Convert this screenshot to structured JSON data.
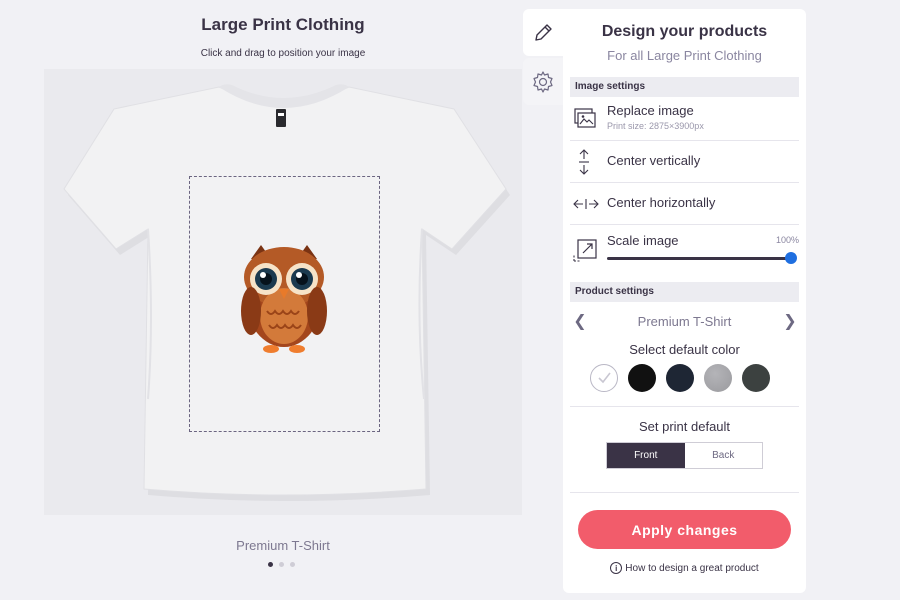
{
  "preview": {
    "title": "Large Print Clothing",
    "hint": "Click and drag to position your image",
    "product_caption": "Premium T-Shirt",
    "carousel": {
      "pages": 3,
      "active_index": 0
    }
  },
  "panel": {
    "title": "Design your products",
    "subtitle": "For all Large Print Clothing",
    "image_settings": {
      "heading": "Image settings",
      "replace_label": "Replace image",
      "print_size": "Print size: 2875×3900px",
      "center_vertical_label": "Center vertically",
      "center_horizontal_label": "Center horizontally",
      "scale_label": "Scale image",
      "scale_value": "100%",
      "scale_fraction": 1.0
    },
    "product_settings": {
      "heading": "Product settings",
      "product_name": "Premium T-Shirt",
      "color_label": "Select default color",
      "colors": [
        {
          "name": "white",
          "hex": "#ffffff",
          "selected": true
        },
        {
          "name": "black",
          "hex": "#111111",
          "selected": false
        },
        {
          "name": "navy",
          "hex": "#1e2634",
          "selected": false
        },
        {
          "name": "heather-grey",
          "hex": "#9a9a9e",
          "selected": false
        },
        {
          "name": "charcoal",
          "hex": "#3c4140",
          "selected": false
        }
      ],
      "print_default_label": "Set print default",
      "front_label": "Front",
      "back_label": "Back",
      "print_default_selected": "Front"
    },
    "apply_label": "Apply changes",
    "help_label": "How to design a great product"
  },
  "colors": {
    "accent": "#f25c6b",
    "dark": "#3a3346",
    "slider_thumb": "#1f6fe0"
  },
  "icons": {
    "edit_tab": "pencil-icon",
    "settings_tab": "gear-icon",
    "replace": "image-icon",
    "vertical": "vertical-arrows-icon",
    "horizontal": "horizontal-arrows-icon",
    "scale": "scale-icon",
    "prev": "chevron-left-icon",
    "next": "chevron-right-icon",
    "info": "info-icon"
  }
}
